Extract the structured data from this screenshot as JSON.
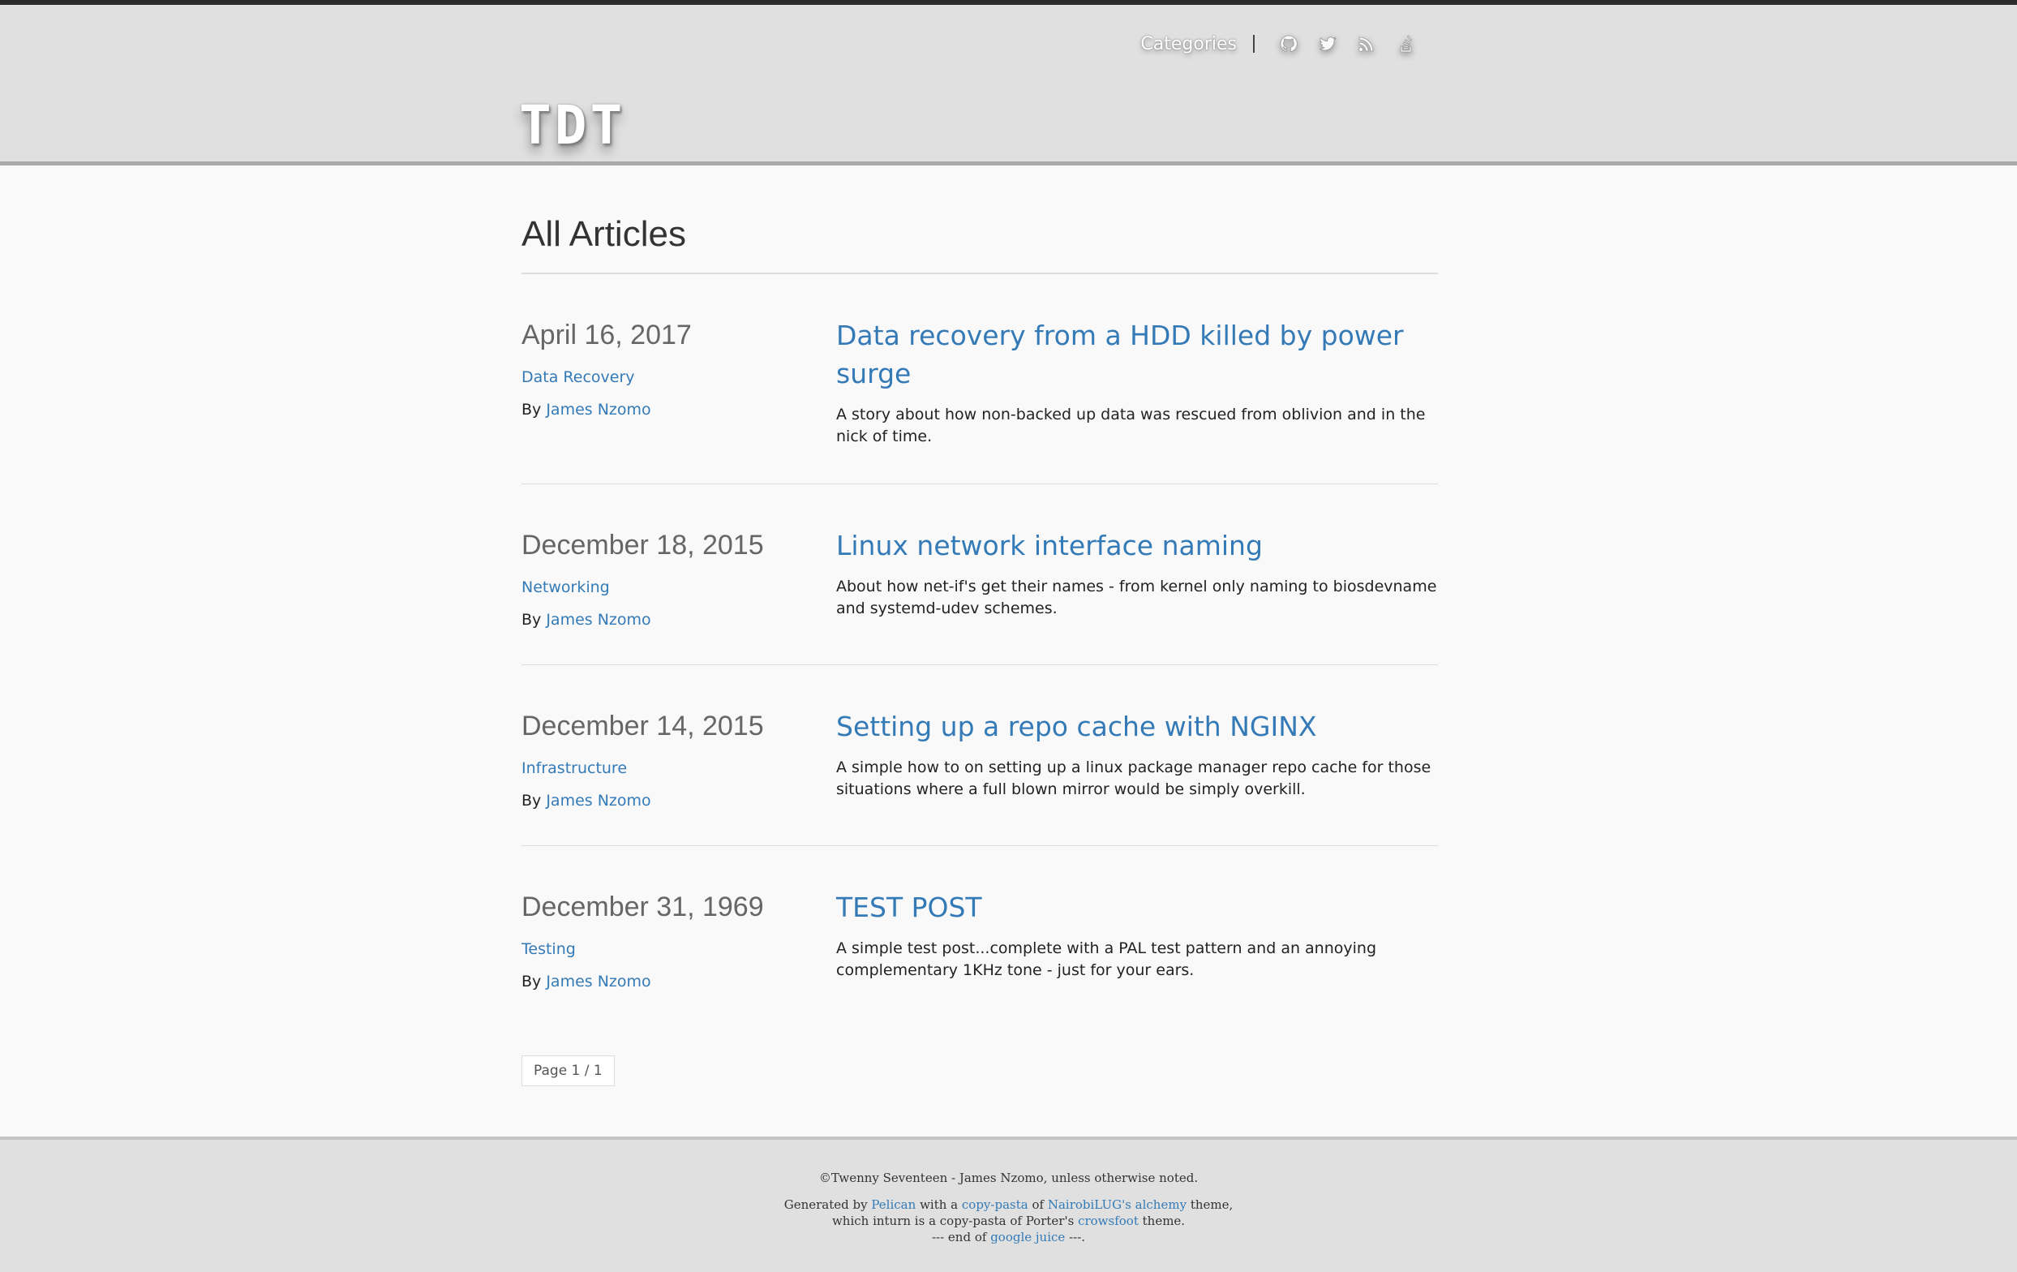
{
  "header": {
    "logo": "TDT",
    "nav": {
      "categories_label": "Categories",
      "icons": [
        "github-icon",
        "twitter-icon",
        "rss-icon",
        "stackoverflow-icon"
      ]
    }
  },
  "main": {
    "page_title": "All Articles",
    "by_label": "By",
    "articles": [
      {
        "date": "April 16, 2017",
        "category": "Data Recovery",
        "author": "James Nzomo",
        "title": "Data recovery from a HDD killed by power surge",
        "summary": "A story about how non-backed up data was rescued from oblivion and in the nick of time."
      },
      {
        "date": "December 18, 2015",
        "category": "Networking",
        "author": "James Nzomo",
        "title": "Linux network interface naming",
        "summary": "About how net-if's get their names - from kernel only naming to biosdevname and systemd-udev schemes."
      },
      {
        "date": "December 14, 2015",
        "category": "Infrastructure",
        "author": "James Nzomo",
        "title": "Setting up a repo cache with NGINX",
        "summary": "A simple how to on setting up a linux package manager repo cache for those situations where a full blown mirror would be simply overkill."
      },
      {
        "date": "December 31, 1969",
        "category": "Testing",
        "author": "James Nzomo",
        "title": "TEST POST",
        "summary": "A simple test post...complete with a PAL test pattern and an annoying complementary 1KHz tone - just for your ears."
      }
    ],
    "pager": "Page 1 / 1"
  },
  "footer": {
    "copyright": "©Twenny Seventeen - James Nzomo, unless otherwise noted.",
    "generated_by": "Generated by",
    "pelican": "Pelican",
    "with_a": "with a",
    "copy_pasta": "copy-pasta",
    "of": "of",
    "alchemy": "NairobiLUG's alchemy",
    "theme1": "theme,",
    "inturn": "which inturn is a copy-pasta of Porter's",
    "crowsfoot": "crowsfoot",
    "theme2": "theme.",
    "end_prefix": "--- end of",
    "google_juice": "google juice",
    "end_suffix": "---."
  }
}
